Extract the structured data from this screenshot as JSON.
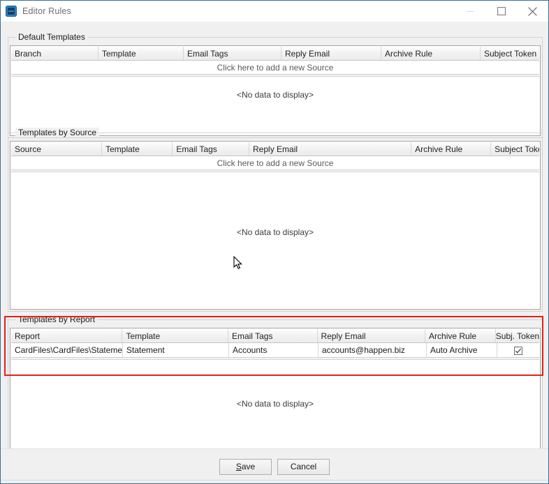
{
  "window": {
    "title": "Editor Rules",
    "icon": "app-icon",
    "controls": {
      "minimize": "minimize-icon",
      "maximize": "maximize-icon",
      "close": "close-icon"
    },
    "accent_color": "#3c6e94",
    "highlight_color": "#e32119"
  },
  "sections": [
    {
      "title": "Default Templates",
      "columns": [
        "Branch",
        "Template",
        "Email Tags",
        "Reply Email",
        "Archive Rule",
        "Subject Token"
      ],
      "new_row_text": "Click here to add a new Source",
      "rows": [],
      "empty_text": "<No data to display>"
    },
    {
      "title": "Templates by Source",
      "columns": [
        "Source",
        "Template",
        "Email Tags",
        "Reply Email",
        "Archive Rule",
        "Subject Token"
      ],
      "new_row_text": "Click here to add a new Source",
      "rows": [],
      "empty_text": "<No data to display>"
    },
    {
      "title": "Templates by Report",
      "columns": [
        "Report",
        "Template",
        "Email Tags",
        "Reply Email",
        "Archive Rule",
        "Subj. Token"
      ],
      "new_row_text": "",
      "rows": [
        {
          "report": "CardFiles\\CardFiles\\Statement",
          "template": "Statement",
          "email_tags": "Accounts",
          "reply_email": "accounts@happen.biz",
          "archive_rule": "Auto Archive",
          "subject_token": true
        }
      ],
      "empty_text": "<No data to display>"
    }
  ],
  "footer": {
    "save_label_prefix": "",
    "save_accel": "S",
    "save_label_rest": "ave",
    "save_label": "Save",
    "cancel_label": "Cancel"
  }
}
